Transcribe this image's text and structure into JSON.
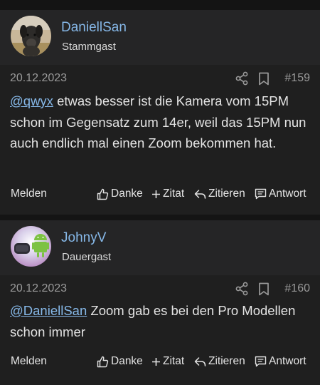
{
  "posts": [
    {
      "username": "DaniellSan",
      "user_title": "Stammgast",
      "date": "20.12.2023",
      "post_number": "#159",
      "mention": "@qwyx",
      "text": " etwas besser ist die Kamera vom 15PM schon im Gegensatz zum 14er, weil das 15PM nun auch endlich mal einen Zoom bekommen hat.",
      "actions": {
        "report": "Melden",
        "like": "Danke",
        "quote": "Zitat",
        "cite": "Zitieren",
        "answer": "Antwort"
      }
    },
    {
      "username": "JohnyV",
      "user_title": "Dauergast",
      "date": "20.12.2023",
      "post_number": "#160",
      "mention": "@DaniellSan",
      "text": " Zoom gab es bei den Pro Modellen schon immer",
      "actions": {
        "report": "Melden",
        "like": "Danke",
        "quote": "Zitat",
        "cite": "Zitieren",
        "answer": "Antwort"
      }
    }
  ],
  "icons": {
    "share": "share-icon",
    "bookmark": "bookmark-icon",
    "like": "thumbs-up-icon",
    "quote": "plus-icon",
    "cite": "reply-icon",
    "answer": "message-icon"
  },
  "colors": {
    "link": "#86b8e8",
    "text": "#e4e4e4",
    "muted": "#9a9a9a",
    "background": "#141414",
    "card": "#1f1f1f",
    "header": "#252526"
  }
}
